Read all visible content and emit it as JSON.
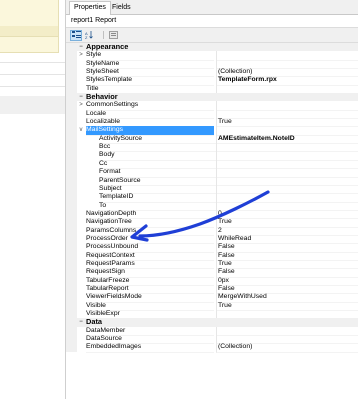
{
  "tabs": [
    {
      "label": "Properties",
      "active": true
    },
    {
      "label": "Fields",
      "active": false
    }
  ],
  "object_name": "report1 Report",
  "toolbar": {
    "categorized_icon": "categorized-icon",
    "alphabetical_icon": "alphabetical-icon",
    "property_pages_icon": "property-pages-icon"
  },
  "annotation_color": "#1f3fd6",
  "selection_color": "#3399ff",
  "rows": [
    {
      "type": "cat",
      "name": "Appearance",
      "expander": "−"
    },
    {
      "type": "prop",
      "name": "Style",
      "value": "",
      "expander": ">"
    },
    {
      "type": "prop",
      "name": "StyleName",
      "value": ""
    },
    {
      "type": "prop",
      "name": "StyleSheet",
      "value": "(Collection)"
    },
    {
      "type": "prop",
      "name": "StylesTemplate",
      "value": "TemplateForm.rpx",
      "bold": true
    },
    {
      "type": "prop",
      "name": "Title",
      "value": ""
    },
    {
      "type": "cat",
      "name": "Behavior",
      "expander": "−"
    },
    {
      "type": "prop",
      "name": "CommonSettings",
      "value": "",
      "expander": ">"
    },
    {
      "type": "prop",
      "name": "Locale",
      "value": ""
    },
    {
      "type": "prop",
      "name": "Localizable",
      "value": "True"
    },
    {
      "type": "prop",
      "name": "MailSettings",
      "value": "",
      "expander": "v",
      "selected": true
    },
    {
      "type": "prop",
      "name": "ActivitySource",
      "value": "AMEstimateItem.NoteID",
      "bold": true,
      "sub": true
    },
    {
      "type": "prop",
      "name": "Bcc",
      "value": "",
      "sub": true
    },
    {
      "type": "prop",
      "name": "Body",
      "value": "",
      "sub": true
    },
    {
      "type": "prop",
      "name": "Cc",
      "value": "",
      "sub": true
    },
    {
      "type": "prop",
      "name": "Format",
      "value": "",
      "sub": true
    },
    {
      "type": "prop",
      "name": "ParentSource",
      "value": "",
      "sub": true
    },
    {
      "type": "prop",
      "name": "Subject",
      "value": "",
      "sub": true
    },
    {
      "type": "prop",
      "name": "TemplateID",
      "value": "",
      "sub": true
    },
    {
      "type": "prop",
      "name": "To",
      "value": "",
      "sub": true
    },
    {
      "type": "prop",
      "name": "NavigationDepth",
      "value": "0"
    },
    {
      "type": "prop",
      "name": "NavigationTree",
      "value": "True"
    },
    {
      "type": "prop",
      "name": "ParamsColumns",
      "value": "2"
    },
    {
      "type": "prop",
      "name": "ProcessOrder",
      "value": "WhileRead"
    },
    {
      "type": "prop",
      "name": "ProcessUnbound",
      "value": "False"
    },
    {
      "type": "prop",
      "name": "RequestContext",
      "value": "False"
    },
    {
      "type": "prop",
      "name": "RequestParams",
      "value": "True"
    },
    {
      "type": "prop",
      "name": "RequestSign",
      "value": "False"
    },
    {
      "type": "prop",
      "name": "TabularFreeze",
      "value": "0px"
    },
    {
      "type": "prop",
      "name": "TabularReport",
      "value": "False"
    },
    {
      "type": "prop",
      "name": "ViewerFieldsMode",
      "value": "MergeWithUsed"
    },
    {
      "type": "prop",
      "name": "Visible",
      "value": "True"
    },
    {
      "type": "prop",
      "name": "VisibleExpr",
      "value": ""
    },
    {
      "type": "cat",
      "name": "Data",
      "expander": "−"
    },
    {
      "type": "prop",
      "name": "DataMember",
      "value": ""
    },
    {
      "type": "prop",
      "name": "DataSource",
      "value": ""
    },
    {
      "type": "prop",
      "name": "EmbeddedImages",
      "value": "(Collection)"
    }
  ]
}
